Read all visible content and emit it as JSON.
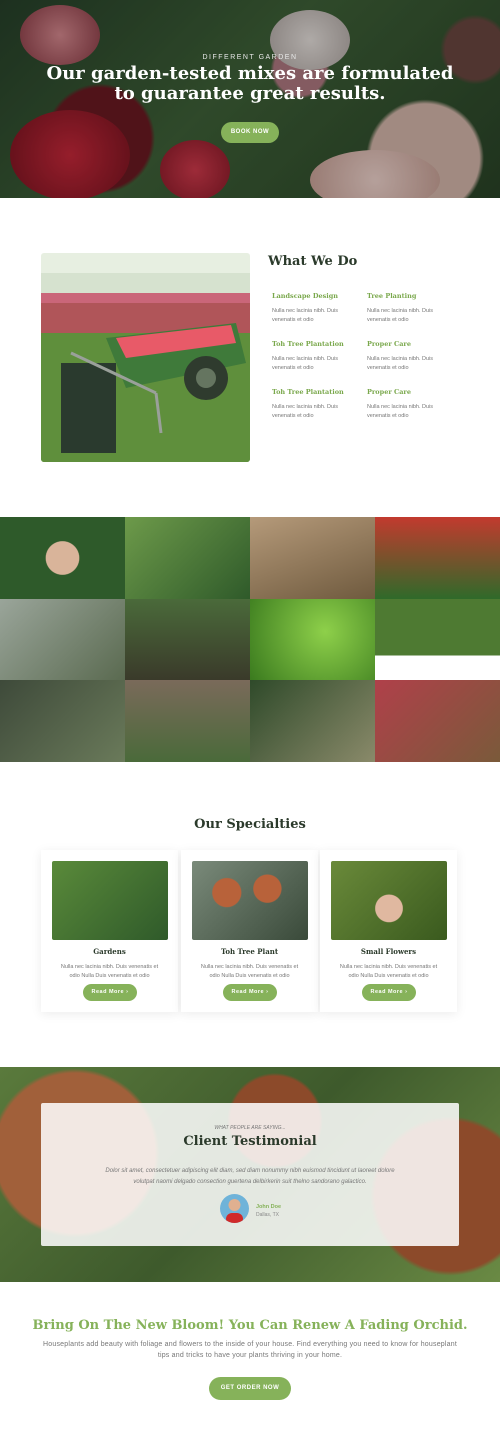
{
  "hero": {
    "subtitle": "DIFFERENT GARDEN",
    "title": "Our garden-tested mixes are formulated to guarantee great results.",
    "button": "BOOK NOW"
  },
  "what_we_do": {
    "title": "What We Do",
    "services": [
      {
        "title": "Landscape Design",
        "text": "Nulla nec lacinia nibh. Duis venenatis et odio"
      },
      {
        "title": "Tree Planting",
        "text": "Nulla nec lacinia nibh. Duis venenatis et odio"
      },
      {
        "title": "Toh Tree Plantation",
        "text": "Nulla nec lacinia nibh. Duis venenatis et odio"
      },
      {
        "title": "Proper Care",
        "text": "Nulla nec lacinia nibh. Duis venenatis et odio"
      },
      {
        "title": "Toh Tree Plantation",
        "text": "Nulla nec lacinia nibh. Duis venenatis et odio"
      },
      {
        "title": "Proper Care",
        "text": "Nulla nec lacinia nibh. Duis venenatis et odio"
      }
    ]
  },
  "specialties": {
    "title": "Our Specialties",
    "cards": [
      {
        "title": "Gardens",
        "text": "Nulla nec lacinia nibh. Duis venenatis et odio Nulla Duis venenatis et odio",
        "button": "Read More"
      },
      {
        "title": "Toh Tree Plant",
        "text": "Nulla nec lacinia nibh. Duis venenatis et odio Nulla Duis venenatis et odio",
        "button": "Read More"
      },
      {
        "title": "Small Flowers",
        "text": "Nulla nec lacinia nibh. Duis venenatis et odio Nulla Duis venenatis et odio",
        "button": "Read More"
      }
    ],
    "button_arrow": "›"
  },
  "testimonial": {
    "subtitle": "WHAT PEOPLE ARE SAYING...",
    "title": "Client Testimonial",
    "quote": "Dolor sit amet, consectetuer adipiscing elit diam, sed diam nonummy nibh euismod tincidunt ut laoreet dolore volutpat naomi delgado consection guertena delbirkerin suit thelno sandorano galactico.",
    "name": "John Doe",
    "location": "Dallas, TX"
  },
  "cta": {
    "title": "Bring On The New Bloom! You Can Renew A Fading Orchid.",
    "text": "Houseplants add beauty with foliage and flowers to the inside of your house. Find everything you need to know for houseplant tips and tricks to have your plants thriving in your home.",
    "button": "GET ORDER NOW"
  },
  "colors": {
    "accent": "#86b25a",
    "heading": "#2b3a2b"
  }
}
